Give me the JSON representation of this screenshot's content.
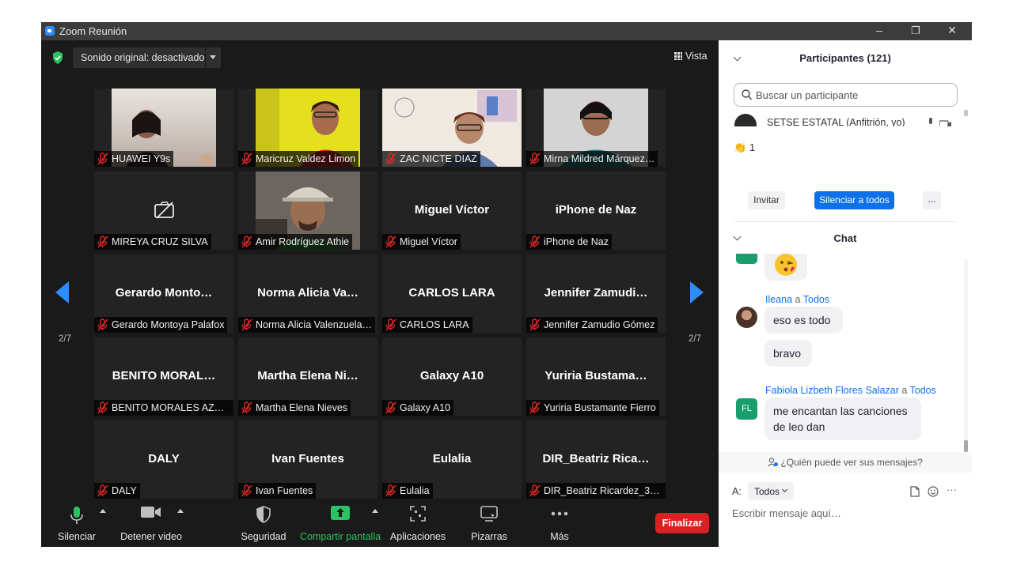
{
  "window": {
    "title": "Zoom Reunión",
    "controls": {
      "minimize": "–",
      "restore": "❐",
      "close": "✕"
    }
  },
  "meeting": {
    "sound_label": "Sonido original: desactivado",
    "view_label": "Vista",
    "page_left": "2/7",
    "page_right": "2/7"
  },
  "tiles": [
    {
      "name": "HUAWEI Y9s",
      "display": "",
      "video": true
    },
    {
      "name": "Maricruz Valdez Limon",
      "display": "",
      "video": true
    },
    {
      "name": "ZAC NICTE DIAZ",
      "display": "",
      "video": true
    },
    {
      "name": "Mirna Mildred Márquez…",
      "display": "",
      "video": true
    },
    {
      "name": "MIREYA CRUZ SILVA",
      "display": "",
      "video": false,
      "camera_off_icon": "camera-off-icon"
    },
    {
      "name": "Amir Rodríguez Athie",
      "display": "",
      "video": true
    },
    {
      "name": "Miguel Víctor",
      "display": "Miguel Víctor",
      "video": false
    },
    {
      "name": "iPhone de Naz",
      "display": "iPhone de Naz",
      "video": false
    },
    {
      "name": "Gerardo Montoya Palafox",
      "display": "Gerardo  Monto…",
      "video": false
    },
    {
      "name": "Norma Alicia Valenzuela…",
      "display": "Norma  Alicia  Va…",
      "video": false
    },
    {
      "name": "CARLOS LARA",
      "display": "CARLOS LARA",
      "video": false
    },
    {
      "name": "Jennifer Zamudio Gómez",
      "display": "Jennifer  Zamudi…",
      "video": false
    },
    {
      "name": "BENITO MORALES AZA…",
      "display": "BENITO  MORAL…",
      "video": false
    },
    {
      "name": "Martha Elena Nieves",
      "display": "Martha  Elena  Ni…",
      "video": false
    },
    {
      "name": "Galaxy A10",
      "display": "Galaxy A10",
      "video": false
    },
    {
      "name": "Yuriria Bustamante Fierro",
      "display": "Yuriria  Bustama…",
      "video": false
    },
    {
      "name": "DALY",
      "display": "DALY",
      "video": false
    },
    {
      "name": "Ivan Fuentes",
      "display": "Ivan Fuentes",
      "video": false
    },
    {
      "name": "Eulalia",
      "display": "Eulalia",
      "video": false
    },
    {
      "name": "DIR_Beatriz Ricardez_30…",
      "display": "DIR_Beatriz  Rica…",
      "video": false
    }
  ],
  "toolbar": {
    "mute": "Silenciar",
    "video": "Detener video",
    "security": "Seguridad",
    "share": "Compartir pantalla",
    "apps": "Aplicaciones",
    "whiteboards": "Pizarras",
    "more": "Más",
    "end": "Finalizar"
  },
  "participants": {
    "title": "Participantes (121)",
    "search_placeholder": "Buscar un participante",
    "host_name": "SETSE ESTATAL (Anfitrión, yo)",
    "reaction_count": "1",
    "invite": "Invitar",
    "mute_all": "Silenciar a todos",
    "more": "..."
  },
  "chat": {
    "title": "Chat",
    "messages": [
      {
        "sender": "Ileana",
        "to_word": "a",
        "to": "Todos",
        "texts": [
          "eso es todo",
          "bravo"
        ]
      },
      {
        "sender": "Fabiola Lizbeth Flores Salazar",
        "to_word": "a",
        "to": "Todos",
        "initials": "FL",
        "texts": [
          "me encantan las canciones",
          "de leo dan"
        ]
      }
    ],
    "who_can_see": "¿Quién puede ver sus mensajes?",
    "to_label": "A:",
    "to_value": "Todos",
    "input_placeholder": "Escribir mensaje aquí…",
    "compose_more": "···"
  },
  "colors": {
    "accent": "#2d8cff",
    "send_button": "#0e71eb",
    "end_button": "#d92121",
    "share_green": "#2ac262",
    "mic_green": "#2ac262",
    "muted_red": "#e02828"
  }
}
